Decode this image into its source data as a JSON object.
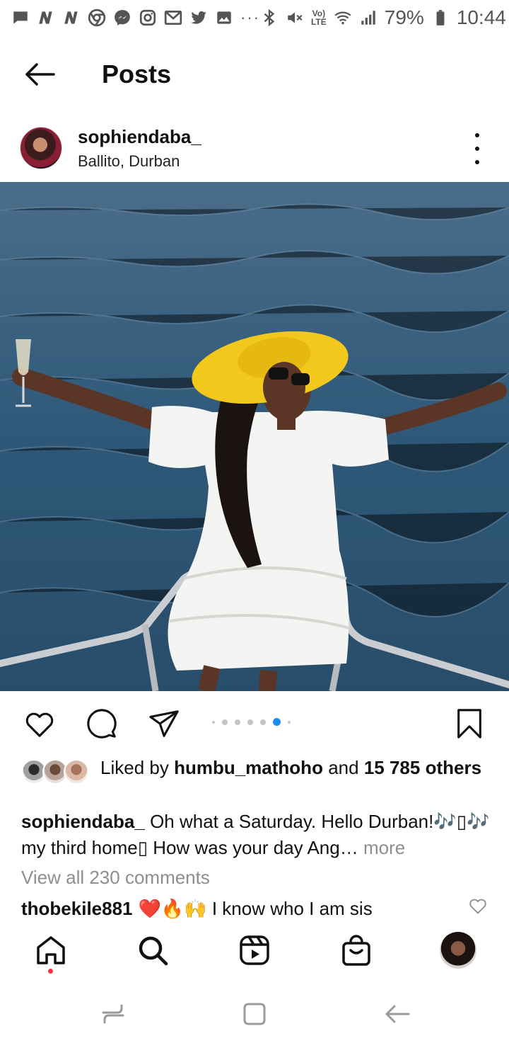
{
  "status_bar": {
    "battery": "79%",
    "time": "10:44",
    "network_label": "LTE",
    "volte_label": "Vo)",
    "more_dots": "···",
    "icons": [
      "message-icon",
      "news-n-icon",
      "news-n-icon",
      "chrome-icon",
      "messenger-icon",
      "instagram-icon",
      "gmail-icon",
      "twitter-icon",
      "gallery-icon",
      "bluetooth-icon",
      "mute-icon",
      "wifi-icon",
      "signal-icon",
      "battery-icon"
    ]
  },
  "header": {
    "title": "Posts",
    "back_icon": "arrow-left-icon"
  },
  "post": {
    "username": "sophiendaba_",
    "location": "Ballito, Durban",
    "carousel": {
      "count": 7,
      "active_index": 5
    },
    "liked_by_prefix": "Liked by",
    "liked_by_user": "humbu_mathoho",
    "liked_by_and": "and",
    "liked_by_count": "15 785",
    "liked_by_suffix": "others",
    "caption_user": "sophiendaba_",
    "caption_text": "Oh what a Saturday. Hello Durban!🎶▯🎶 my third home▯ How was your day Ang…",
    "caption_more": "more",
    "view_comments": "View all 230 comments",
    "comment": {
      "user": "thobekile881",
      "text": "❤️🔥🙌 I know who I am sis"
    }
  },
  "bottom_nav": {
    "items": [
      "home-icon",
      "search-icon",
      "reels-icon",
      "shop-icon",
      "profile-avatar"
    ]
  },
  "colors": {
    "accent_blue": "#1a8cf0",
    "notification_red": "#ff3040",
    "muted_text": "#8e8e8e",
    "hat_yellow": "#f2c81c",
    "sea_blue": "#365d7c"
  }
}
